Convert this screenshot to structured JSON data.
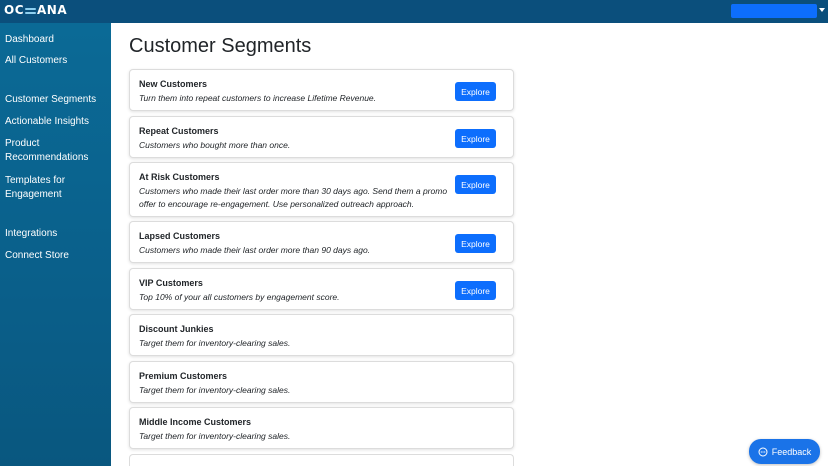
{
  "header": {
    "logo_text_left": "OC",
    "logo_text_right": "ANA"
  },
  "sidebar": {
    "items": [
      {
        "label": "Dashboard"
      },
      {
        "label": "All Customers"
      },
      {
        "label": "Customer Segments"
      },
      {
        "label": "Actionable Insights"
      },
      {
        "label": "Product Recommendations"
      },
      {
        "label": "Templates for Engagement"
      },
      {
        "label": "Integrations"
      },
      {
        "label": "Connect Store"
      }
    ]
  },
  "main": {
    "title": "Customer Segments",
    "explore_label": "Explore",
    "segments": [
      {
        "name": "New Customers",
        "description": "Turn them into repeat customers to increase Lifetime Revenue."
      },
      {
        "name": "Repeat Customers",
        "description": "Customers who bought more than once."
      },
      {
        "name": "At Risk Customers",
        "description": "Customers who made their last order more than 30 days ago. Send them a promo offer to encourage re-engagement. Use personalized outreach approach."
      },
      {
        "name": "Lapsed Customers",
        "description": "Customers who made their last order more than 90 days ago."
      },
      {
        "name": "VIP Customers",
        "description": "Top 10% of your all customers by engagement score."
      },
      {
        "name": "Discount Junkies",
        "description": "Target them for inventory-clearing sales."
      },
      {
        "name": "Premium Customers",
        "description": "Target them for inventory-clearing sales."
      },
      {
        "name": "Middle Income Customers",
        "description": "Target them for inventory-clearing sales."
      }
    ]
  },
  "feedback": {
    "label": "Feedback"
  }
}
